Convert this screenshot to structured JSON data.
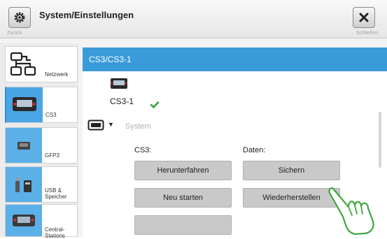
{
  "header": {
    "title": "System/Einstellungen",
    "back_label": "Zurück",
    "close_label": "Schließen"
  },
  "sidebar": {
    "items": [
      {
        "label": "Netzwerk",
        "icon": "network-icon"
      },
      {
        "label": "CS3",
        "icon": "cs3-device-icon"
      },
      {
        "label": "GFP3",
        "icon": "gfp3-device-icon"
      },
      {
        "label": "USB &\nSpeicher",
        "icon": "usb-storage-icon"
      },
      {
        "label": "Central-\nStations",
        "icon": "central-station-icon"
      }
    ]
  },
  "main": {
    "selected_path": "CS3/CS3-1",
    "device_name": "CS3-1",
    "section_label": "System",
    "col_cs3_label": "CS3:",
    "col_data_label": "Daten:",
    "buttons": {
      "shutdown": "Herunterfahren",
      "restart": "Neu starten",
      "backup": "Sichern",
      "restore": "Wiederherstellen"
    }
  },
  "colors": {
    "selection": "#3a9bd9",
    "status_ok": "#3aa33a"
  }
}
